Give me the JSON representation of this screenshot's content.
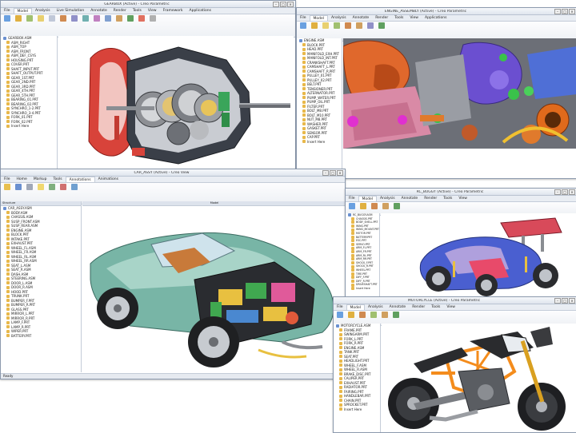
{
  "gearbox_window": {
    "title": "GEARBOX (Active) - Creo Parametric",
    "tabs": [
      "File",
      "Model",
      "Analysis",
      "Live Simulation",
      "Annotate",
      "Render",
      "Tools",
      "View",
      "Framework",
      "Applications"
    ],
    "tree": [
      "GEARBOX.ASM",
      "ASM_RIGHT",
      "ASM_TOP",
      "ASM_FRONT",
      "ASM_DEF_CSYS",
      "HOUSING.PRT",
      "COVER.PRT",
      "SHAFT_INPUT.PRT",
      "SHAFT_OUTPUT.PRT",
      "GEAR_1ST.PRT",
      "GEAR_2ND.PRT",
      "GEAR_3RD.PRT",
      "GEAR_4TH.PRT",
      "GEAR_5TH.PRT",
      "BEARING_01.PRT",
      "BEARING_02.PRT",
      "SYNCHRO_1-2.PRT",
      "SYNCHRO_3-4.PRT",
      "FORK_01.PRT",
      "FORK_02.PRT",
      "Insert Here"
    ]
  },
  "engine_window": {
    "title": "ENGINE_ASSEMBLY (Active) - Creo Parametric",
    "tabs": [
      "File",
      "Model",
      "Analysis",
      "Annotate",
      "Render",
      "Tools",
      "View",
      "Applications"
    ],
    "tree": [
      "ENGINE.ASM",
      "BLOCK.PRT",
      "HEAD.PRT",
      "MANIFOLD_EXH.PRT",
      "MANIFOLD_INT.PRT",
      "CRANKSHAFT.PRT",
      "CAMSHAFT_L.PRT",
      "CAMSHAFT_R.PRT",
      "PULLEY_01.PRT",
      "PULLEY_02.PRT",
      "BELT.PRT",
      "TENSIONER.PRT",
      "ALTERNATOR.PRT",
      "PUMP_WATER.PRT",
      "PUMP_OIL.PRT",
      "FILTER.PRT",
      "BOLT_M8.PRT",
      "BOLT_M10.PRT",
      "NUT_M8.PRT",
      "WASHER.PRT",
      "GASKET.PRT",
      "SENSOR.PRT",
      "CAP.PRT",
      "Insert Here"
    ]
  },
  "car_window": {
    "title": "CAR_ASSY (Active) - Creo View",
    "tabs": [
      "File",
      "Home",
      "Markup",
      "Tools",
      "Annotations",
      "Animations"
    ],
    "panel_header": "Structure",
    "viewport_header": "Model",
    "tree": [
      "CAR_ASSY.ASM",
      "BODY.ASM",
      "CHASSIS.ASM",
      "SUSP_FRONT.ASM",
      "SUSP_REAR.ASM",
      "ENGINE.ASM",
      "BLOCK.PRT",
      "INTAKE.PRT",
      "EXHAUST.PRT",
      "WHEEL_FL.ASM",
      "WHEEL_FR.ASM",
      "WHEEL_RL.ASM",
      "WHEEL_RR.ASM",
      "SEAT_L.ASM",
      "SEAT_R.ASM",
      "DASH.ASM",
      "STEERING.ASM",
      "DOOR_L.ASM",
      "DOOR_R.ASM",
      "HOOD.PRT",
      "TRUNK.PRT",
      "BUMPER_F.PRT",
      "BUMPER_R.PRT",
      "GLASS.PRT",
      "MIRROR_L.PRT",
      "MIRROR_R.PRT",
      "LAMP_F.PRT",
      "LAMP_R.PRT",
      "WIPER.PRT",
      "BATTERY.PRT"
    ],
    "status": "Ready"
  },
  "buggy_window": {
    "title": "RC_BUGGY (Active) - Creo Parametric",
    "tabs": [
      "File",
      "Model",
      "Analysis",
      "Annotate",
      "Render",
      "Tools",
      "View"
    ],
    "tree": [
      "RC_BUGGY.ASM",
      "CHASSIS.PRT",
      "BODY_SHELL.PRT",
      "WING.PRT",
      "WING_MOUNT.PRT",
      "MOTOR.PRT",
      "BATTERY.PRT",
      "ESC.PRT",
      "SERVO.PRT",
      "ARM_FL.PRT",
      "ARM_FR.PRT",
      "ARM_RL.PRT",
      "ARM_RR.PRT",
      "SHOCK_F.PRT",
      "SHOCK_R.PRT",
      "WHEEL.PRT",
      "TIRE.PRT",
      "DIFF_F.PRT",
      "DIFF_R.PRT",
      "DRIVESHAFT.PRT",
      "Insert Here"
    ]
  },
  "moto_window": {
    "title": "MOTORCYCLE (Active) - Creo Parametric",
    "tabs": [
      "File",
      "Model",
      "Analysis",
      "Annotate",
      "Render",
      "Tools",
      "View"
    ],
    "tree": [
      "MOTORCYCLE.ASM",
      "FRAME.PRT",
      "SWINGARM.PRT",
      "FORK_L.PRT",
      "FORK_R.PRT",
      "ENGINE.ASM",
      "TANK.PRT",
      "SEAT.PRT",
      "HEADLIGHT.PRT",
      "WHEEL_F.ASM",
      "WHEEL_R.ASM",
      "BRAKE_DISC.PRT",
      "CALIPER.PRT",
      "EXHAUST.PRT",
      "RADIATOR.PRT",
      "FAIRING.PRT",
      "HANDLEBAR.PRT",
      "CHAIN.PRT",
      "SPROCKET.PRT",
      "Insert Here"
    ]
  },
  "colors": {
    "accent": "#f48c1c",
    "frame": "#8c9aae",
    "tree_icon": "#e8b84a"
  }
}
